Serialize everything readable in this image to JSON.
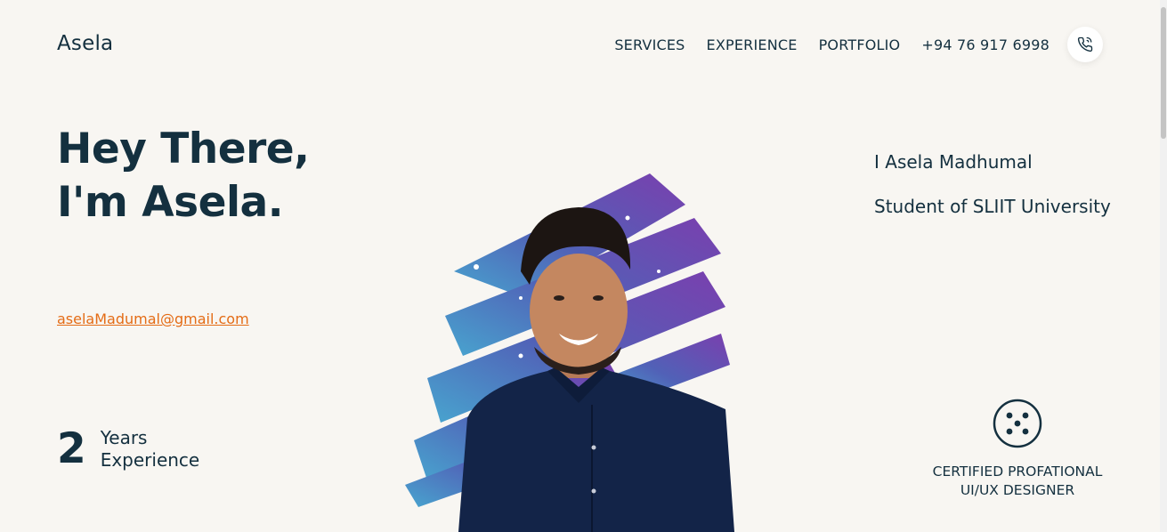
{
  "header": {
    "logo": "Asela",
    "nav": [
      "SERVICES",
      "EXPERIENCE",
      "PORTFOLIO"
    ],
    "phone": "+94 76 917 6998",
    "phone_icon": "phone-call-icon"
  },
  "hero": {
    "title_line1": "Hey There,",
    "title_line2": "I'm Asela.",
    "email": "aselaMadumal@gmail.com",
    "years_number": "2",
    "years_line1": "Years",
    "years_line2": "Experience",
    "intro_name": "I Asela Madhumal",
    "intro_role": "Student of SLIIT University",
    "cert_icon": "dice-five-icon",
    "cert_line1": "CERTIFIED PROFATIONAL",
    "cert_line2": "UI/UX DESIGNER"
  },
  "colors": {
    "background": "#f8f6f2",
    "text": "#14303f",
    "link": "#e46c16",
    "brush_purple": "#6a45b0",
    "brush_blue": "#3f8fc9"
  }
}
